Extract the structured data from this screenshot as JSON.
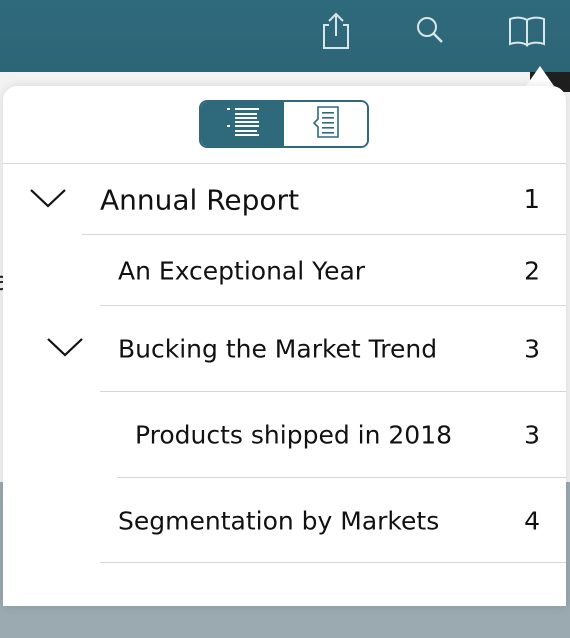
{
  "toolbar": {
    "share_icon": "share-icon",
    "search_icon": "search-icon",
    "book_icon": "book-icon",
    "accent": "#2f6a7c"
  },
  "popover": {
    "segments": [
      {
        "icon": "list-icon",
        "active": true
      },
      {
        "icon": "document-text-icon",
        "active": false
      }
    ]
  },
  "toc": {
    "items": [
      {
        "label": "Annual Report",
        "page": "1",
        "level": 0,
        "expanded": true
      },
      {
        "label": "An Exceptional Year",
        "page": "2",
        "level": 1,
        "expanded": false
      },
      {
        "label": "Bucking the Market Trend",
        "page": "3",
        "level": 1,
        "expanded": true
      },
      {
        "label": "Products shipped in 2018",
        "page": "3",
        "level": 2,
        "expanded": false
      },
      {
        "label": "Segmentation by Markets",
        "page": "4",
        "level": 1,
        "expanded": false
      }
    ]
  }
}
